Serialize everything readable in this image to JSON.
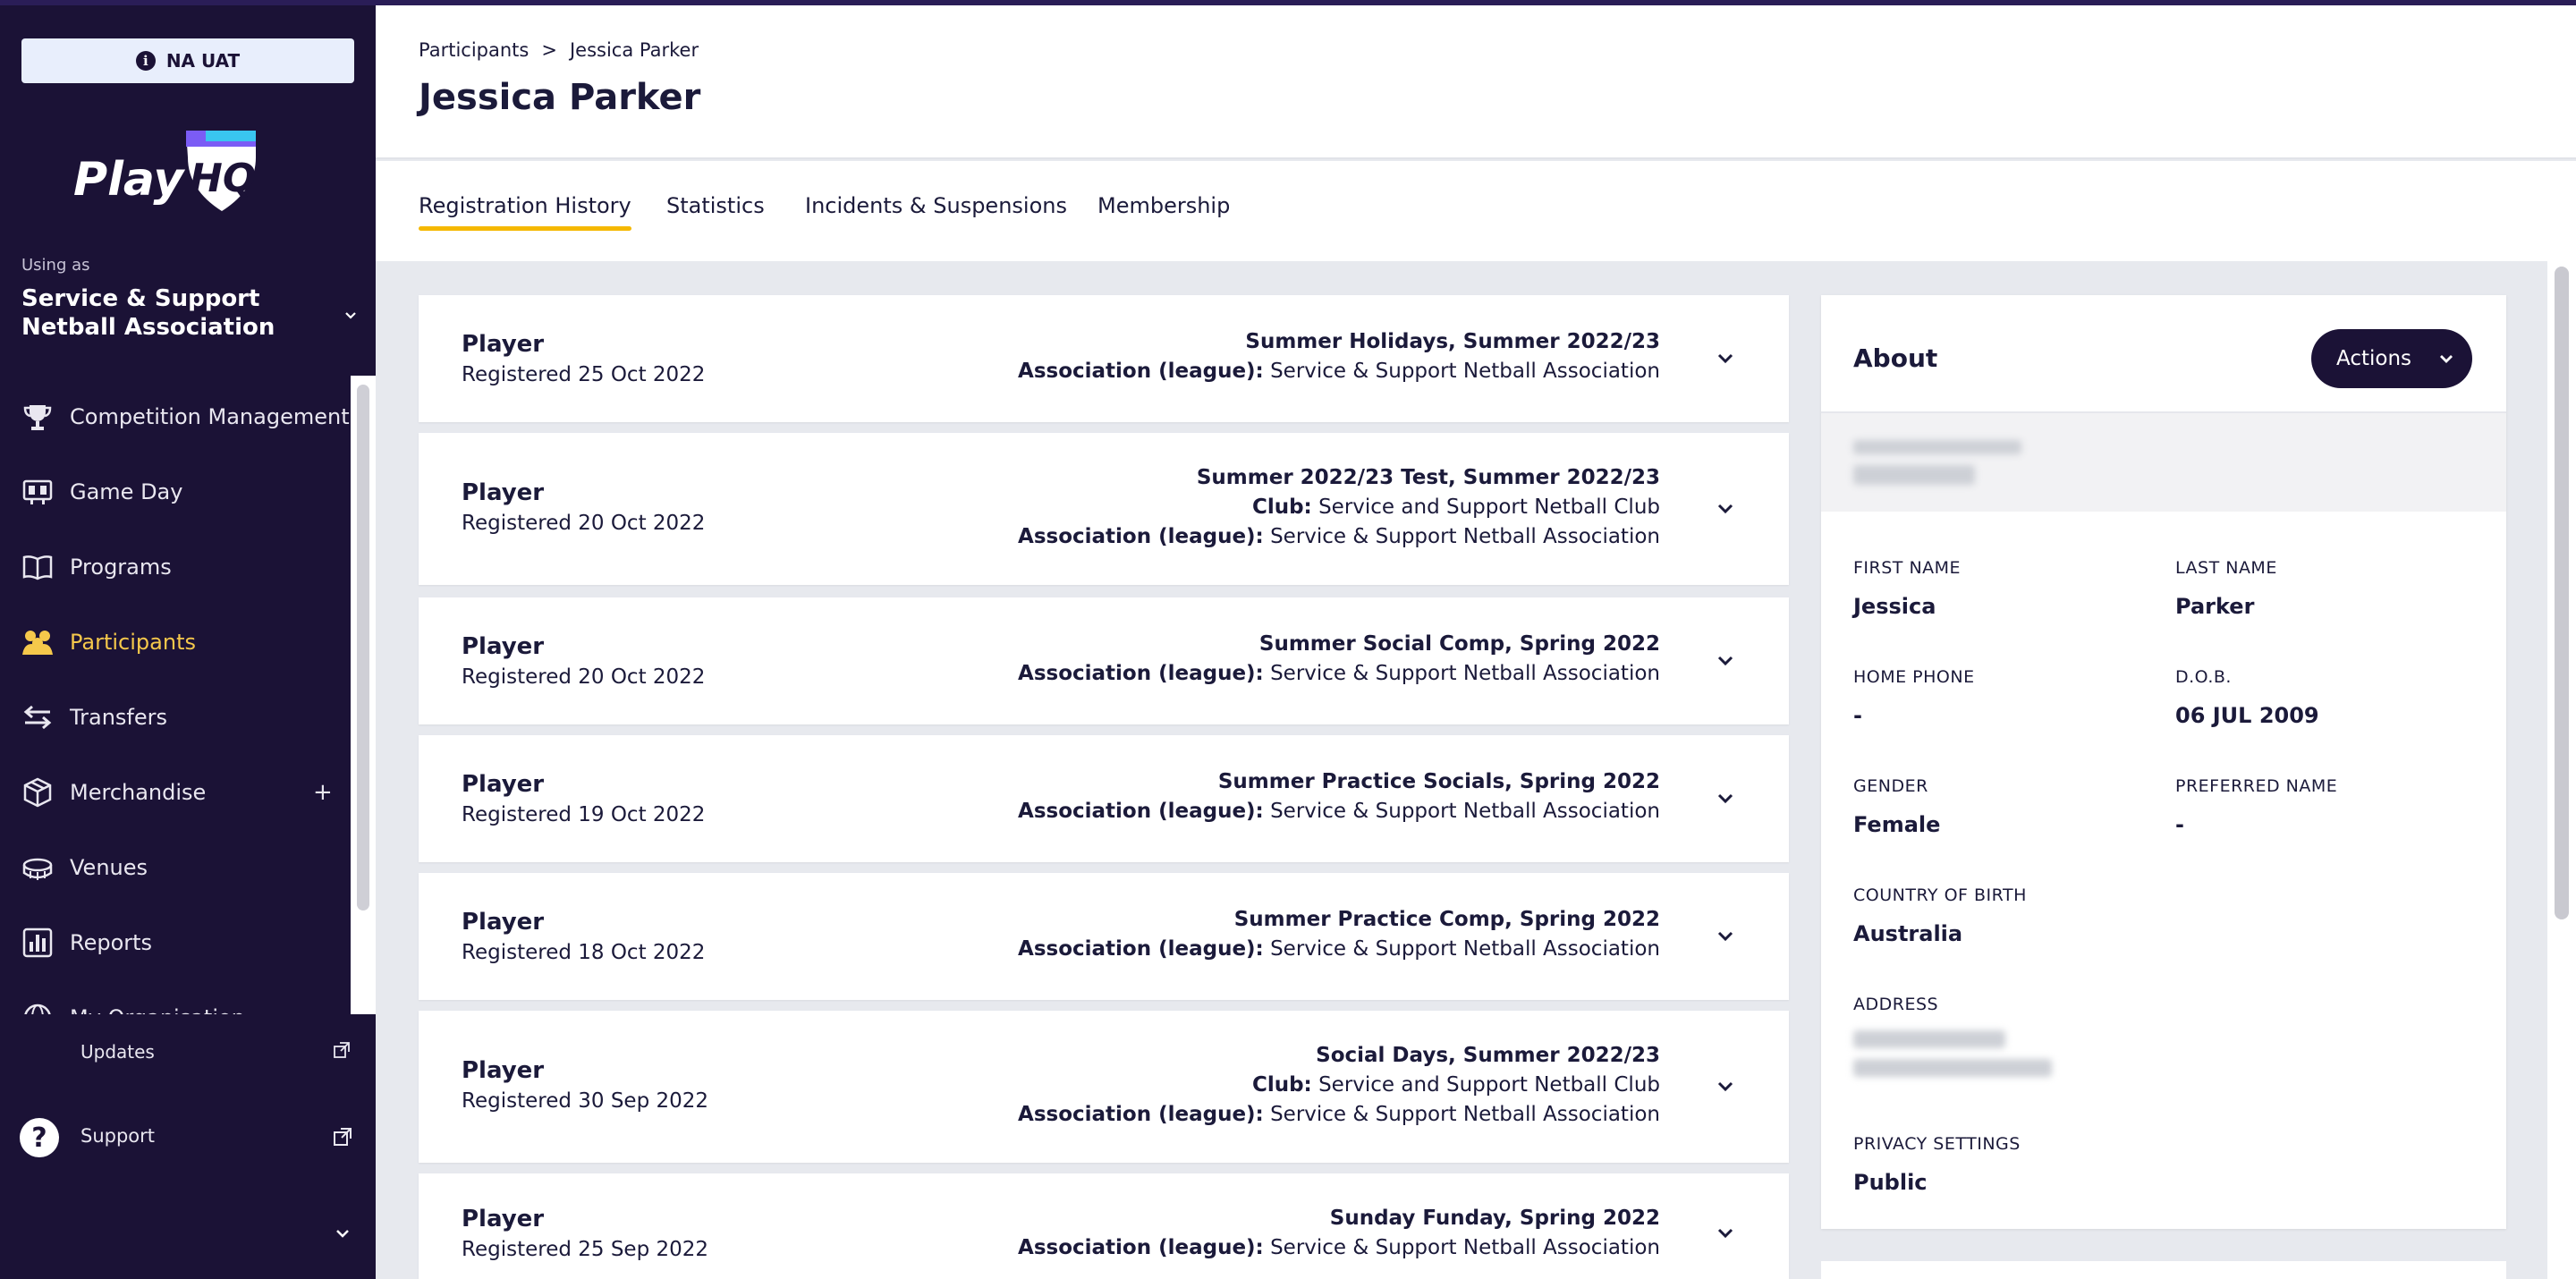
{
  "environment": {
    "badge": "NA UAT",
    "icon": "info-icon"
  },
  "brand": {
    "logo_text": "PlayHQ"
  },
  "org": {
    "using_as_label": "Using as",
    "name": "Service & Support Netball Association"
  },
  "nav": {
    "items": [
      {
        "label": "Competition Management",
        "icon": "trophy-icon"
      },
      {
        "label": "Game Day",
        "icon": "scoreboard-icon"
      },
      {
        "label": "Programs",
        "icon": "book-icon"
      },
      {
        "label": "Participants",
        "icon": "people-icon",
        "active": true
      },
      {
        "label": "Transfers",
        "icon": "arrows-icon"
      },
      {
        "label": "Merchandise",
        "icon": "box-icon",
        "expand": "+"
      },
      {
        "label": "Venues",
        "icon": "stadium-icon"
      },
      {
        "label": "Reports",
        "icon": "reports-icon"
      },
      {
        "label": "My Organisation",
        "icon": "globe-icon"
      }
    ],
    "updates": "Updates",
    "support": "Support"
  },
  "header": {
    "breadcrumb": {
      "parent": "Participants",
      "separator": ">",
      "current": "Jessica Parker"
    },
    "title": "Jessica Parker"
  },
  "tabs": [
    {
      "label": "Registration History",
      "active": true
    },
    {
      "label": "Statistics"
    },
    {
      "label": "Incidents & Suspensions"
    },
    {
      "label": "Membership"
    }
  ],
  "registrations": [
    {
      "role": "Player",
      "date": "Registered 25 Oct 2022",
      "season": "Summer Holidays, Summer 2022/23",
      "club": null,
      "association_label": "Association (league):",
      "association": "Service & Support Netball Association"
    },
    {
      "role": "Player",
      "date": "Registered 20 Oct 2022",
      "season": "Summer 2022/23 Test, Summer 2022/23",
      "club_label": "Club:",
      "club": "Service and Support Netball Club",
      "association_label": "Association (league):",
      "association": "Service & Support Netball Association"
    },
    {
      "role": "Player",
      "date": "Registered 20 Oct 2022",
      "season": "Summer Social Comp, Spring 2022",
      "club": null,
      "association_label": "Association (league):",
      "association": "Service & Support Netball Association"
    },
    {
      "role": "Player",
      "date": "Registered 19 Oct 2022",
      "season": "Summer Practice Socials, Spring 2022",
      "club": null,
      "association_label": "Association (league):",
      "association": "Service & Support Netball Association"
    },
    {
      "role": "Player",
      "date": "Registered 18 Oct 2022",
      "season": "Summer Practice Comp, Spring 2022",
      "club": null,
      "association_label": "Association (league):",
      "association": "Service & Support Netball Association"
    },
    {
      "role": "Player",
      "date": "Registered 30 Sep 2022",
      "season": "Social Days, Summer 2022/23",
      "club_label": "Club:",
      "club": "Service and Support Netball Club",
      "association_label": "Association (league):",
      "association": "Service & Support Netball Association"
    },
    {
      "role": "Player",
      "date": "Registered 25 Sep 2022",
      "season": "Sunday Funday, Spring 2022",
      "club": null,
      "association_label": "Association (league):",
      "association": "Service & Support Netball Association"
    }
  ],
  "about": {
    "title": "About",
    "actions_label": "Actions",
    "fields": {
      "first_name": {
        "label": "FIRST NAME",
        "value": "Jessica"
      },
      "last_name": {
        "label": "LAST NAME",
        "value": "Parker"
      },
      "home_phone": {
        "label": "HOME PHONE",
        "value": "-"
      },
      "dob": {
        "label": "D.O.B.",
        "value": "06 JUL 2009"
      },
      "gender": {
        "label": "GENDER",
        "value": "Female"
      },
      "preferred_name": {
        "label": "PREFERRED NAME",
        "value": "-"
      },
      "country_of_birth": {
        "label": "COUNTRY OF BIRTH",
        "value": "Australia"
      },
      "address": {
        "label": "ADDRESS"
      },
      "privacy": {
        "label": "PRIVACY SETTINGS",
        "value": "Public"
      }
    }
  },
  "colors": {
    "sidebar_bg": "#1b1236",
    "active_nav": "#f5c84b",
    "tab_underline": "#f5b800",
    "page_bg": "#e7e9ee"
  }
}
